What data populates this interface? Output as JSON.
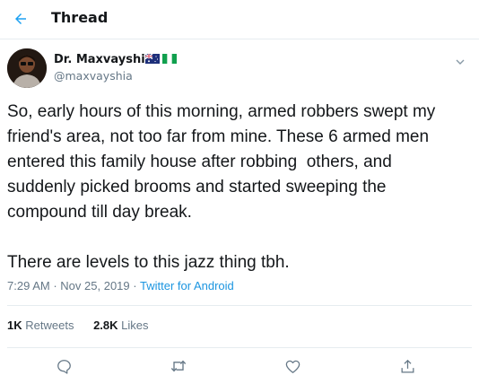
{
  "header": {
    "title": "Thread",
    "back_icon": "arrow-left-icon",
    "accent": "#1da1f2"
  },
  "tweet": {
    "display_name": "Dr. Maxvayshia",
    "handle": "@maxvayshia",
    "flags": [
      "australia-flag-icon",
      "nigeria-flag-icon"
    ],
    "text": "So, early hours of this morning, armed robbers swept my friend's area, not too far from mine. These 6 armed men entered this family house after robbing  others, and suddenly picked brooms and started sweeping the compound till day break.\n\nThere are levels to this jazz thing tbh.",
    "time": "7:29 AM",
    "date": "Nov 25, 2019",
    "separator": "·",
    "source": "Twitter for Android",
    "retweets_count": "1K",
    "retweets_label": "Retweets",
    "likes_count": "2.8K",
    "likes_label": "Likes"
  },
  "actions": {
    "reply_icon": "reply-icon",
    "retweet_icon": "retweet-icon",
    "like_icon": "heart-icon",
    "share_icon": "share-icon"
  },
  "colors": {
    "link": "#1b95e0",
    "secondary_text": "#657786",
    "border": "#e6ecf0"
  }
}
